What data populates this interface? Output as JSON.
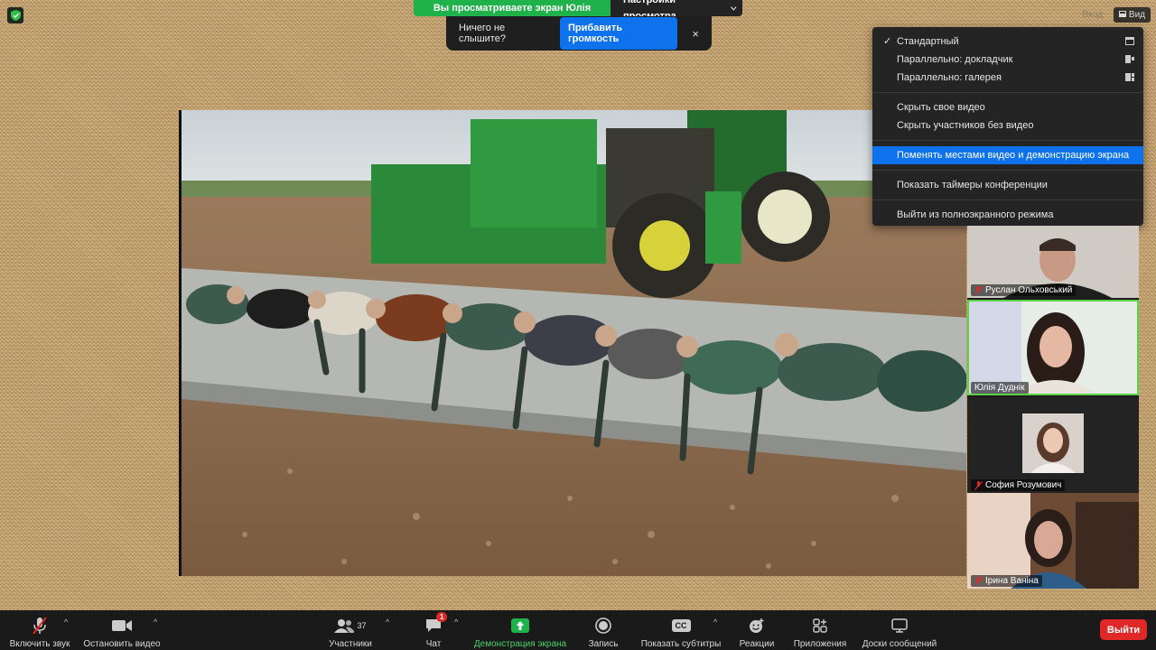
{
  "top": {
    "share_banner": "Вы просматриваете экран Юлія Дуднік",
    "view_settings": "Настройки просмотра",
    "audio_prompt": "Ничего не слышите?",
    "volume_button": "Прибавить громкость",
    "close_symbol": "×",
    "enter_label": "Вход",
    "view_label": "Вид"
  },
  "menu": {
    "items": [
      {
        "label": "Стандартный",
        "checked": true,
        "icon": "standard-layout-icon"
      },
      {
        "label": "Параллельно: докладчик",
        "icon": "side-by-side-speaker-icon"
      },
      {
        "label": "Параллельно: галерея",
        "icon": "side-by-side-gallery-icon"
      },
      {
        "label": "Скрыть свое видео"
      },
      {
        "label": "Скрыть участников без видео"
      },
      {
        "label": "Поменять местами видео и демонстрацию экрана",
        "active": true
      },
      {
        "label": "Показать таймеры конференции"
      },
      {
        "label": "Выйти из полноэкранного режима"
      }
    ],
    "check_symbol": "✓"
  },
  "participants": [
    {
      "name": "Руслан Ольховський",
      "muted": true
    },
    {
      "name": "Юлія Дуднік",
      "muted": false,
      "speaking": true
    },
    {
      "name": "София Розумович",
      "muted": true
    },
    {
      "name": "Ірина Ваніна",
      "muted": true
    }
  ],
  "toolbar": {
    "unmute": "Включить звук",
    "stop_video": "Остановить видео",
    "participants": "Участники",
    "participants_count": "37",
    "chat": "Чат",
    "chat_badge": "1",
    "share": "Демонстрация экрана",
    "record": "Запись",
    "captions": "Показать субтитры",
    "captions_icon_text": "CC",
    "reactions": "Реакции",
    "apps": "Приложения",
    "whiteboards": "Доски сообщений",
    "leave": "Выйти",
    "caret": "^"
  },
  "colors": {
    "accent_blue": "#0e72ed",
    "share_green": "#1fb14a",
    "leave_red": "#e02828",
    "mute_red": "#e02828"
  }
}
